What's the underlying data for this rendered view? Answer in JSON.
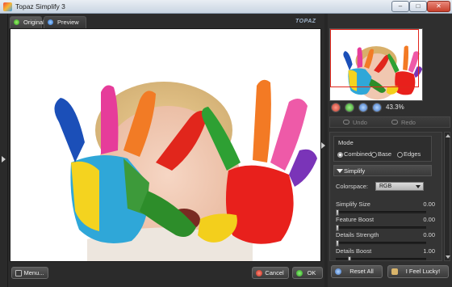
{
  "window": {
    "title": "Topaz Simplify 3",
    "min": "–",
    "max": "□",
    "close": "✕"
  },
  "logo_text": "TOPAZ",
  "tabs": [
    {
      "label": "Original",
      "icon": "green-dot-icon"
    },
    {
      "label": "Preview",
      "icon": "blue-dot-icon"
    }
  ],
  "bottom": {
    "menu_label": "Menu...",
    "cancel_label": "Cancel",
    "ok_label": "OK"
  },
  "navigator": {
    "zoom": "43.3%"
  },
  "history": {
    "undo_label": "Undo",
    "redo_label": "Redo"
  },
  "mode": {
    "title": "Mode",
    "options": [
      "Combined",
      "Base",
      "Edges"
    ],
    "selected": "Combined"
  },
  "simplify": {
    "title": "Simplify",
    "colorspace_label": "Colorspace:",
    "colorspace_value": "RGB",
    "sliders": [
      {
        "label": "Simplify Size",
        "value": "0.00",
        "fraction": 0.0
      },
      {
        "label": "Feature Boost",
        "value": "0.00",
        "fraction": 0.0
      },
      {
        "label": "Details Strength",
        "value": "0.00",
        "fraction": 0.0
      },
      {
        "label": "Details Boost",
        "value": "1.00",
        "fraction": 0.14
      }
    ]
  },
  "actions": {
    "reset_label": "Reset All",
    "lucky_label": "I Feel Lucky!"
  },
  "colors": {
    "accent_red": "#e1261c",
    "panel_bg": "#2f2f2f"
  }
}
